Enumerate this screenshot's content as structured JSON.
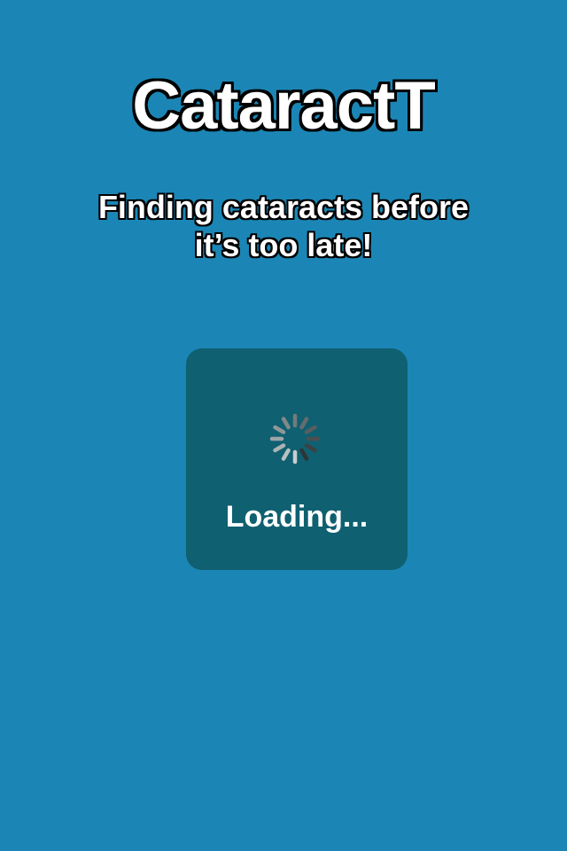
{
  "app": {
    "title": "CataractT",
    "tagline_line1": "Finding cataracts before",
    "tagline_line2": "it’s too late!"
  },
  "loading_panel": {
    "label": "Loading...",
    "spinner_icon": "spinner-icon"
  },
  "colors": {
    "background": "#1b86b5",
    "panel": "#0f6070",
    "text": "#ffffff",
    "outline": "#000000"
  }
}
